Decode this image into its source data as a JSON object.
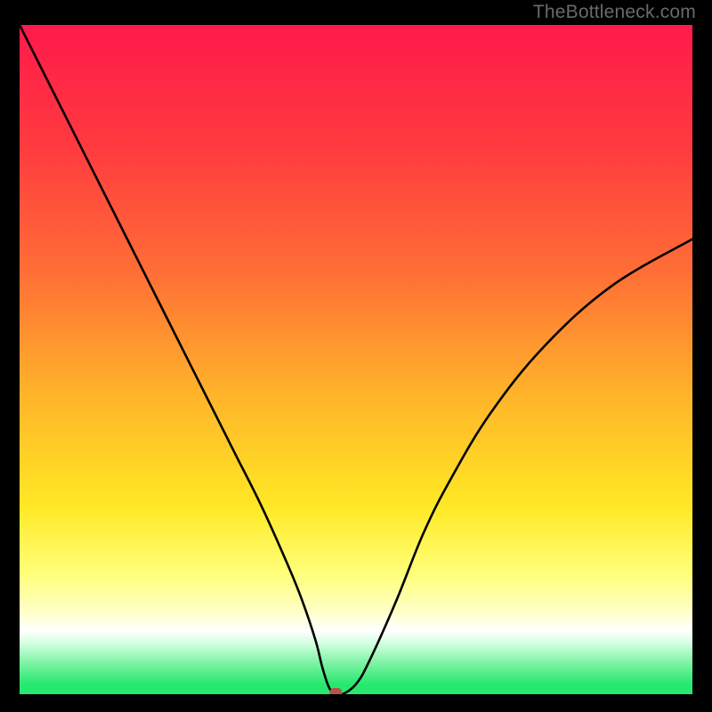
{
  "watermark": "TheBottleneck.com",
  "colors": {
    "top": "#ff1a4b",
    "mid1": "#ff6e36",
    "mid2": "#ffb32a",
    "mid3": "#ffe824",
    "pale": "#ffffc5",
    "green": "#27e86f",
    "curve": "#000000",
    "marker": "#b1564e"
  },
  "chart_data": {
    "type": "line",
    "title": "",
    "xlabel": "",
    "ylabel": "",
    "xlim": [
      0,
      100
    ],
    "ylim": [
      0,
      100
    ],
    "series": [
      {
        "name": "bottleneck-curve",
        "x": [
          0,
          4,
          8,
          12,
          16,
          20,
          24,
          28,
          32,
          36,
          40,
          42,
          44,
          45,
          46,
          47,
          48,
          50,
          52,
          56,
          60,
          64,
          70,
          78,
          88,
          100
        ],
        "values": [
          100,
          92,
          84,
          76,
          68,
          60,
          52,
          44,
          36,
          28,
          19,
          14,
          8,
          4,
          1,
          0,
          0,
          1.5,
          5,
          14,
          24,
          32,
          42,
          52,
          61,
          68
        ]
      }
    ],
    "marker": {
      "x": 47,
      "y": 0
    }
  }
}
